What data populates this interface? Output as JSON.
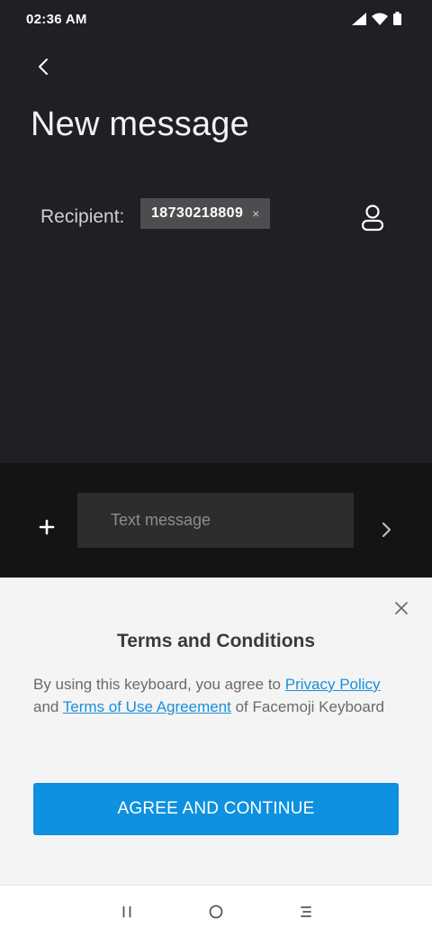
{
  "status_bar": {
    "time": "02:36 AM",
    "icons": [
      "signal-icon",
      "wifi-icon",
      "battery-icon"
    ]
  },
  "header": {
    "back_icon": "back-chevron-icon",
    "title": "New message"
  },
  "recipient": {
    "label": "Recipient:",
    "chip": "18730218809",
    "chip_remove": "×",
    "contact_icon": "person-icon"
  },
  "compose": {
    "add_icon": "plus-icon",
    "placeholder": "Text message",
    "value": "",
    "send_icon": "chevron-right-icon"
  },
  "terms": {
    "close_icon": "close-icon",
    "title": "Terms and Conditions",
    "text_1": "By using this keyboard, you agree to ",
    "link_privacy": "Privacy Policy",
    "text_2": " and ",
    "link_terms": "Terms of Use Agreement",
    "text_3": " of Facemoji Keyboard",
    "agree_button": "AGREE AND CONTINUE"
  },
  "nav_bar": {
    "recents_icon": "recents-icon",
    "home_icon": "home-icon",
    "back_icon": "back-icon"
  },
  "colors": {
    "background": "#1f1f24",
    "compose_bar": "#141414",
    "accent": "#0d91e0",
    "link": "#1a8fdd",
    "panel": "#f4f4f4"
  }
}
